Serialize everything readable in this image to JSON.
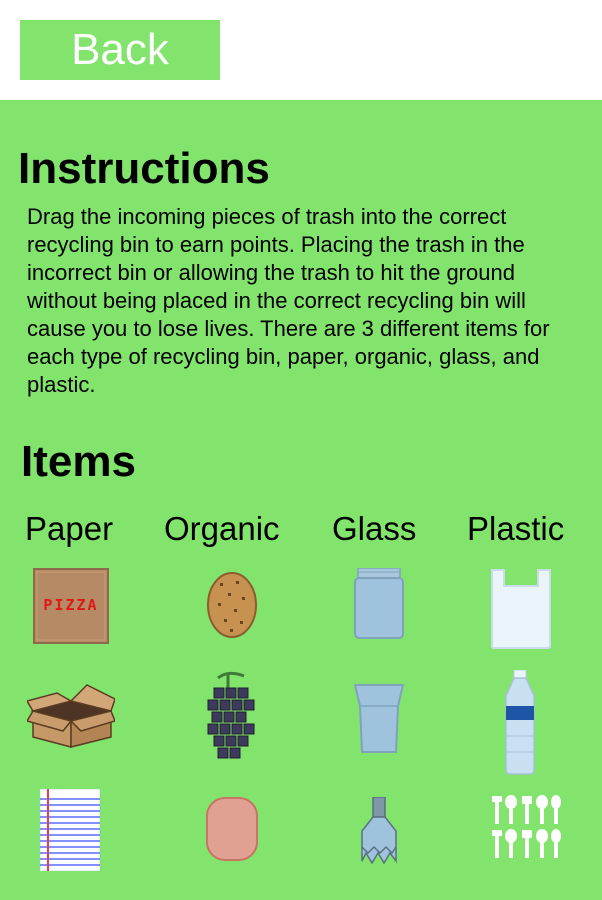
{
  "header": {
    "back_label": "Back"
  },
  "instructions": {
    "title": "Instructions",
    "text": "Drag the incoming pieces of trash into the correct recycling bin to earn points. Placing the trash in the incorrect bin or allowing the trash to hit the ground without being placed in the correct recycling bin will cause you to lose lives. There are 3 different items for each type of recycling bin, paper, organic, glass, and plastic."
  },
  "items": {
    "title": "Items",
    "categories": [
      {
        "label": "Paper",
        "items": [
          {
            "icon": "pizza-box-icon",
            "text": "PIZZA"
          },
          {
            "icon": "cardboard-box-icon"
          },
          {
            "icon": "notebook-paper-icon"
          }
        ]
      },
      {
        "label": "Organic",
        "items": [
          {
            "icon": "potato-icon"
          },
          {
            "icon": "grapes-icon"
          },
          {
            "icon": "ham-slice-icon"
          }
        ]
      },
      {
        "label": "Glass",
        "items": [
          {
            "icon": "glass-jar-icon"
          },
          {
            "icon": "drinking-glass-icon"
          },
          {
            "icon": "broken-bottle-icon"
          }
        ]
      },
      {
        "label": "Plastic",
        "items": [
          {
            "icon": "plastic-bag-icon"
          },
          {
            "icon": "plastic-bottle-icon"
          },
          {
            "icon": "plastic-utensils-icon"
          }
        ]
      }
    ]
  },
  "colors": {
    "background": "#82e46d",
    "button": "#82e46d",
    "button_text": "#ffffff",
    "text": "#000000"
  }
}
